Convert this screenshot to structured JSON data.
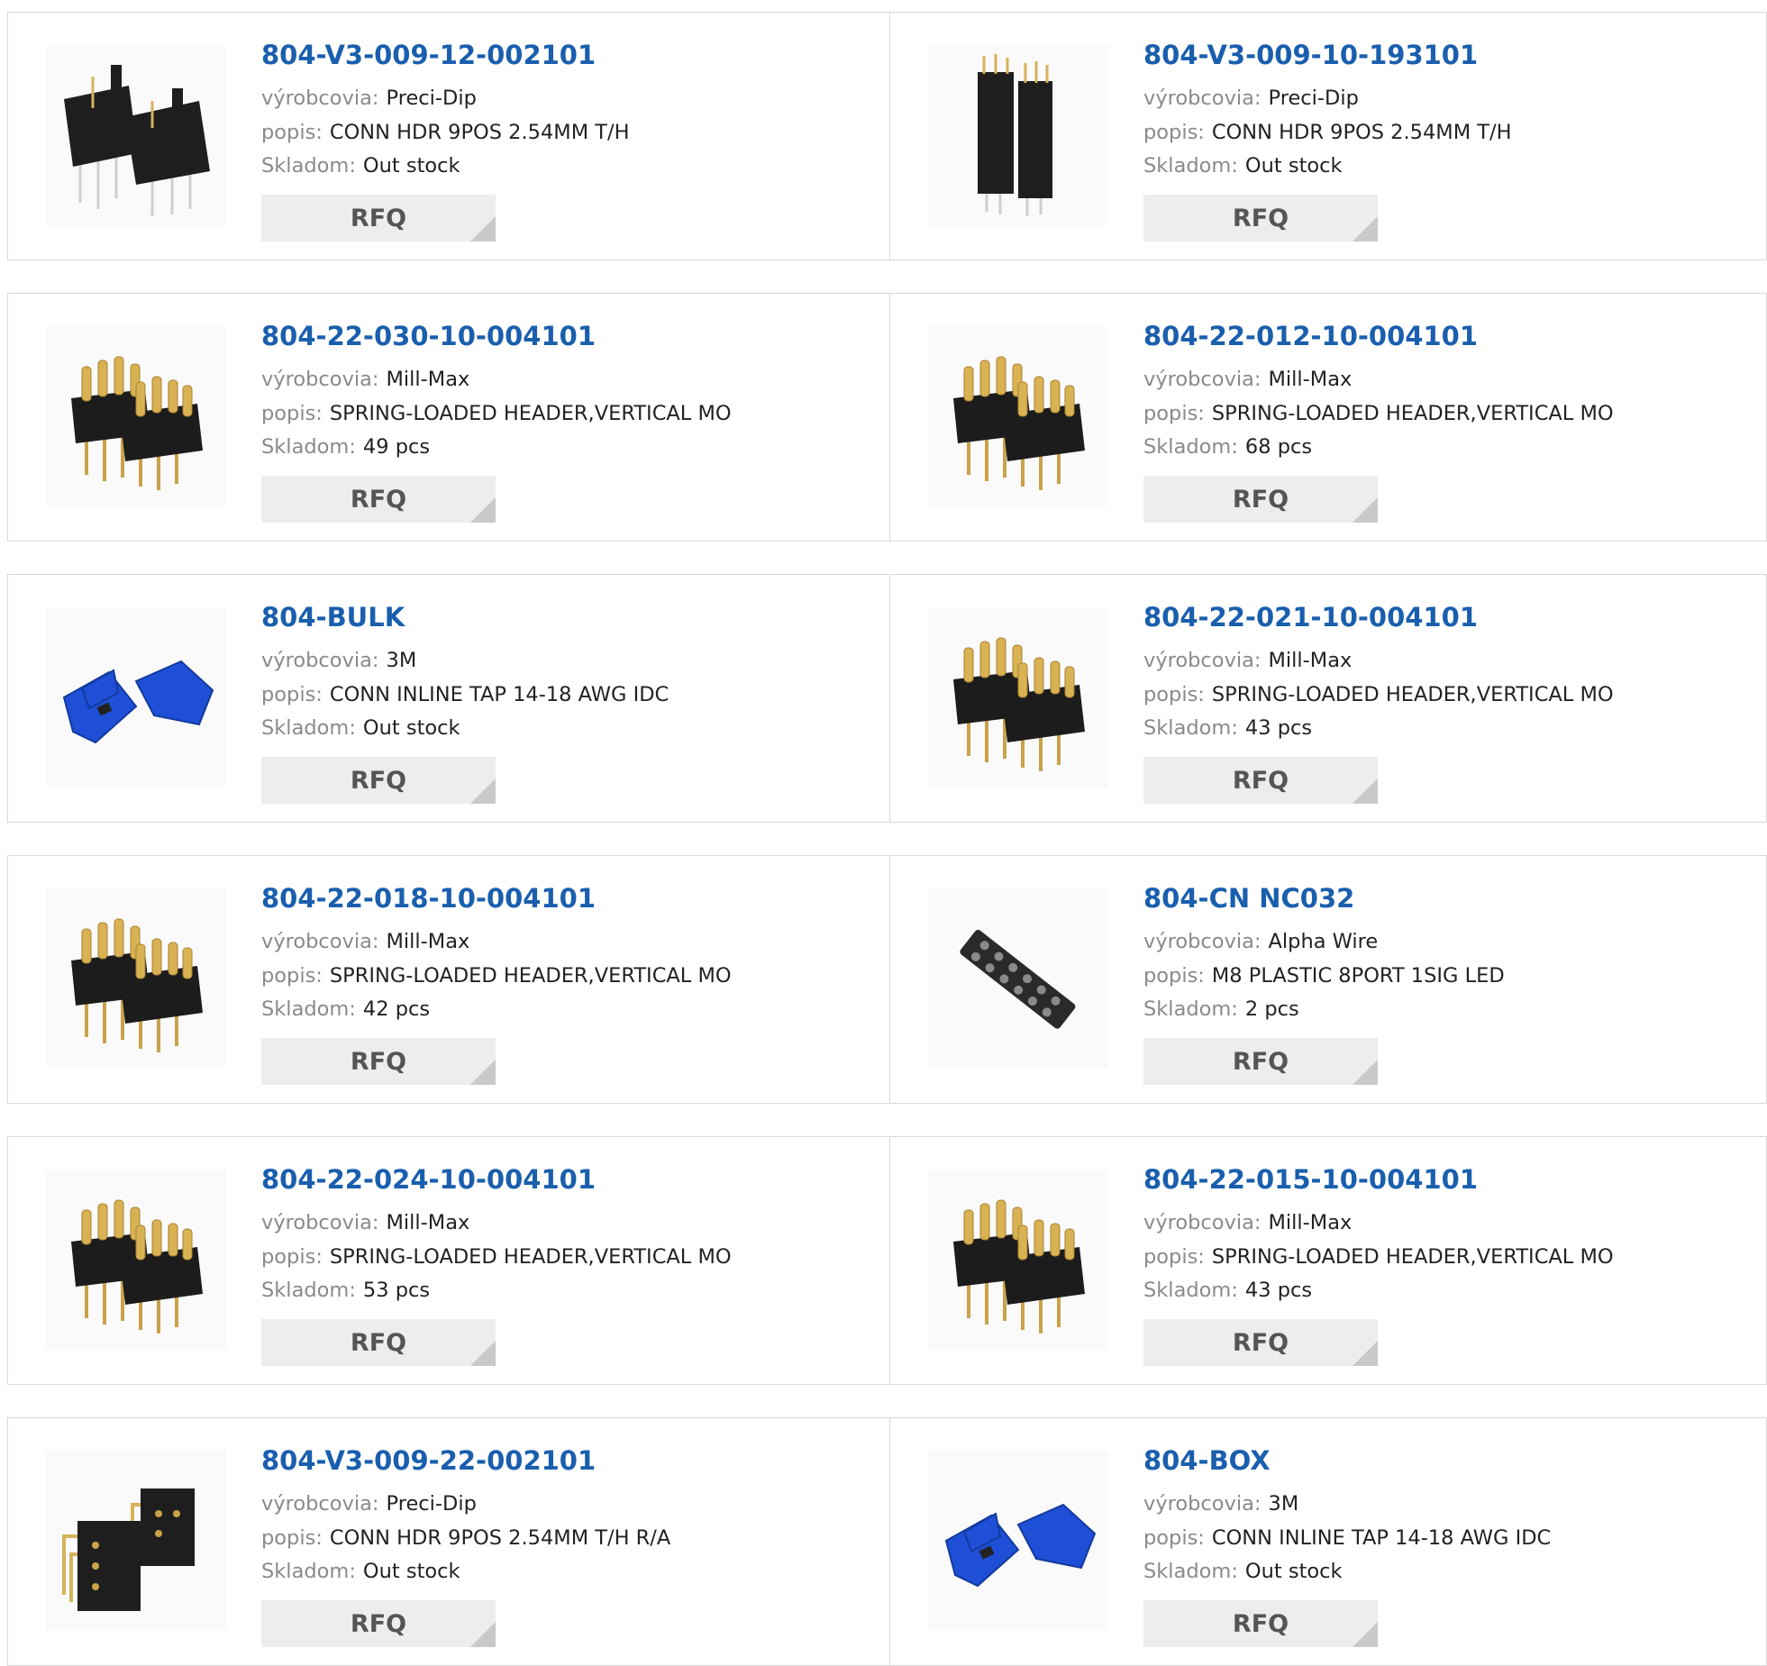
{
  "labels": {
    "manufacturer": "výrobcovia:",
    "description": "popis:",
    "stock": "Skladom:",
    "rfq": "RFQ"
  },
  "colors": {
    "link": "#1a5fae",
    "label": "#8a8a8a",
    "button_bg": "#ededed"
  },
  "products": [
    {
      "pn": "804-V3-009-12-002101",
      "manufacturer": "Preci-Dip",
      "description": "CONN HDR 9POS 2.54MM T/H",
      "stock": "Out stock",
      "image": "black-double-header-icon"
    },
    {
      "pn": "804-V3-009-10-193101",
      "manufacturer": "Preci-Dip",
      "description": "CONN HDR 9POS 2.54MM T/H",
      "stock": "Out stock",
      "image": "black-tall-header-icon"
    },
    {
      "pn": "804-22-030-10-004101",
      "manufacturer": "Mill-Max",
      "description": "SPRING-LOADED HEADER,VERTICAL MO",
      "stock": "49 pcs",
      "image": "gold-pin-header-icon"
    },
    {
      "pn": "804-22-012-10-004101",
      "manufacturer": "Mill-Max",
      "description": "SPRING-LOADED HEADER,VERTICAL MO",
      "stock": "68 pcs",
      "image": "gold-pin-header-icon"
    },
    {
      "pn": "804-BULK",
      "manufacturer": "3M",
      "description": "CONN INLINE TAP 14-18 AWG IDC",
      "stock": "Out stock",
      "image": "blue-tap-connector-icon"
    },
    {
      "pn": "804-22-021-10-004101",
      "manufacturer": "Mill-Max",
      "description": "SPRING-LOADED HEADER,VERTICAL MO",
      "stock": "43 pcs",
      "image": "gold-pin-header-icon"
    },
    {
      "pn": "804-22-018-10-004101",
      "manufacturer": "Mill-Max",
      "description": "SPRING-LOADED HEADER,VERTICAL MO",
      "stock": "42 pcs",
      "image": "gold-pin-header-icon"
    },
    {
      "pn": "804-CN NC032",
      "manufacturer": "Alpha Wire",
      "description": "M8 PLASTIC 8PORT 1SIG LED",
      "stock": "2 pcs",
      "image": "m8-distribution-block-icon"
    },
    {
      "pn": "804-22-024-10-004101",
      "manufacturer": "Mill-Max",
      "description": "SPRING-LOADED HEADER,VERTICAL MO",
      "stock": "53 pcs",
      "image": "gold-pin-header-icon"
    },
    {
      "pn": "804-22-015-10-004101",
      "manufacturer": "Mill-Max",
      "description": "SPRING-LOADED HEADER,VERTICAL MO",
      "stock": "43 pcs",
      "image": "gold-pin-header-icon"
    },
    {
      "pn": "804-V3-009-22-002101",
      "manufacturer": "Preci-Dip",
      "description": "CONN HDR 9POS 2.54MM T/H R/A",
      "stock": "Out stock",
      "image": "right-angle-header-icon"
    },
    {
      "pn": "804-BOX",
      "manufacturer": "3M",
      "description": "CONN INLINE TAP 14-18 AWG IDC",
      "stock": "Out stock",
      "image": "blue-tap-connector-icon"
    }
  ]
}
